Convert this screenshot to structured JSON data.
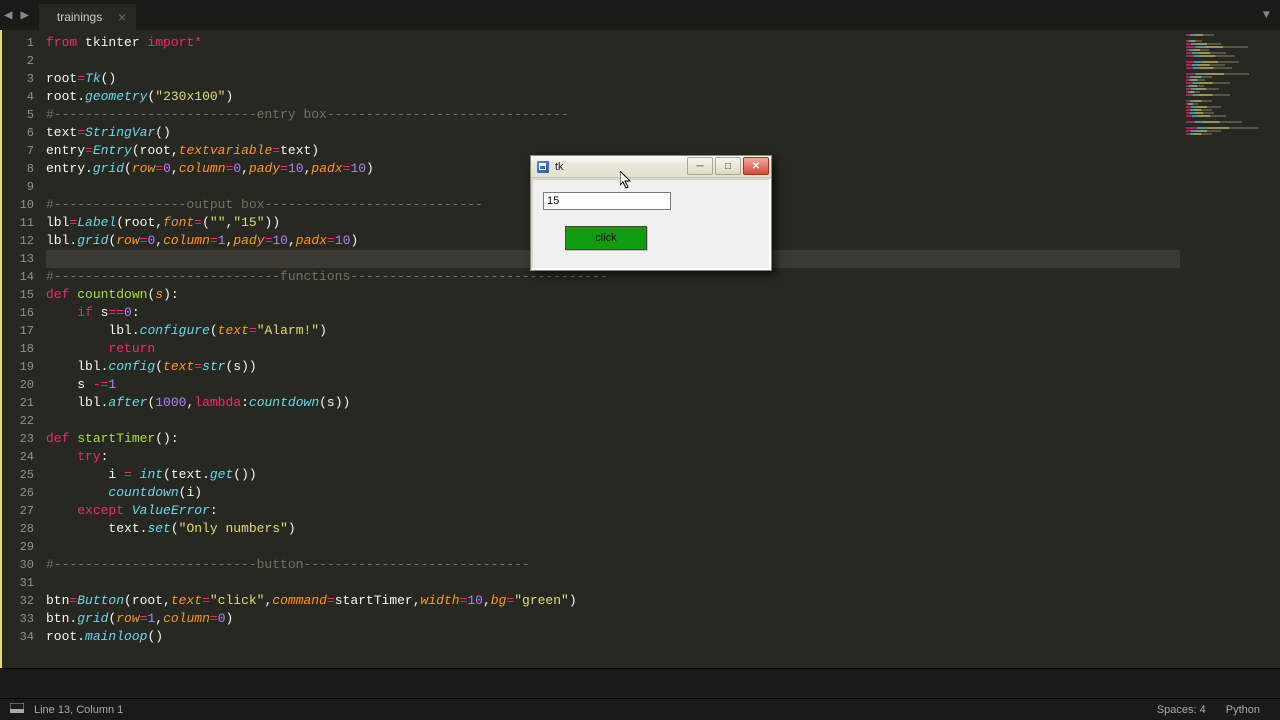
{
  "tabbar": {
    "tab_label": "trainings"
  },
  "gutter": {
    "start": 1,
    "end": 34
  },
  "code": {
    "lines": [
      [
        [
          "kw",
          "from"
        ],
        [
          "pl",
          " tkinter "
        ],
        [
          "kw",
          "import"
        ],
        [
          "op",
          "*"
        ]
      ],
      [
        [
          "pl",
          ""
        ]
      ],
      [
        [
          "pl",
          "root"
        ],
        [
          "op",
          "="
        ],
        [
          "ty",
          "Tk"
        ],
        [
          "pl",
          "()"
        ]
      ],
      [
        [
          "pl",
          "root"
        ],
        [
          "pl",
          "."
        ],
        [
          "fn",
          "geometry"
        ],
        [
          "pl",
          "("
        ],
        [
          "str",
          "\"230x100\""
        ],
        [
          "pl",
          ")"
        ]
      ],
      [
        [
          "cm",
          "#--------------------------entry box-------------------------------"
        ]
      ],
      [
        [
          "pl",
          "text"
        ],
        [
          "op",
          "="
        ],
        [
          "ty",
          "StringVar"
        ],
        [
          "pl",
          "()"
        ]
      ],
      [
        [
          "pl",
          "entry"
        ],
        [
          "op",
          "="
        ],
        [
          "ty",
          "Entry"
        ],
        [
          "pl",
          "(root,"
        ],
        [
          "prm",
          "textvariable"
        ],
        [
          "op",
          "="
        ],
        [
          "pl",
          "text)"
        ]
      ],
      [
        [
          "pl",
          "entry"
        ],
        [
          "pl",
          "."
        ],
        [
          "fn",
          "grid"
        ],
        [
          "pl",
          "("
        ],
        [
          "prm",
          "row"
        ],
        [
          "op",
          "="
        ],
        [
          "num",
          "0"
        ],
        [
          "pl",
          ","
        ],
        [
          "prm",
          "column"
        ],
        [
          "op",
          "="
        ],
        [
          "num",
          "0"
        ],
        [
          "pl",
          ","
        ],
        [
          "prm",
          "pady"
        ],
        [
          "op",
          "="
        ],
        [
          "num",
          "10"
        ],
        [
          "pl",
          ","
        ],
        [
          "prm",
          "padx"
        ],
        [
          "op",
          "="
        ],
        [
          "num",
          "10"
        ],
        [
          "pl",
          ")"
        ]
      ],
      [
        [
          "pl",
          ""
        ]
      ],
      [
        [
          "cm",
          "#-----------------output box----------------------------"
        ]
      ],
      [
        [
          "pl",
          "lbl"
        ],
        [
          "op",
          "="
        ],
        [
          "ty",
          "Label"
        ],
        [
          "pl",
          "(root,"
        ],
        [
          "prm",
          "font"
        ],
        [
          "op",
          "="
        ],
        [
          "pl",
          "("
        ],
        [
          "str",
          "\"\""
        ],
        [
          "pl",
          ","
        ],
        [
          "str",
          "\"15\""
        ],
        [
          "pl",
          "))"
        ]
      ],
      [
        [
          "pl",
          "lbl"
        ],
        [
          "pl",
          "."
        ],
        [
          "fn",
          "grid"
        ],
        [
          "pl",
          "("
        ],
        [
          "prm",
          "row"
        ],
        [
          "op",
          "="
        ],
        [
          "num",
          "0"
        ],
        [
          "pl",
          ","
        ],
        [
          "prm",
          "column"
        ],
        [
          "op",
          "="
        ],
        [
          "num",
          "1"
        ],
        [
          "pl",
          ","
        ],
        [
          "prm",
          "pady"
        ],
        [
          "op",
          "="
        ],
        [
          "num",
          "10"
        ],
        [
          "pl",
          ","
        ],
        [
          "prm",
          "padx"
        ],
        [
          "op",
          "="
        ],
        [
          "num",
          "10"
        ],
        [
          "pl",
          ")"
        ]
      ],
      [
        [
          "pl",
          ""
        ]
      ],
      [
        [
          "cm",
          "#-----------------------------functions---------------------------------"
        ]
      ],
      [
        [
          "kw",
          "def"
        ],
        [
          "pl",
          " "
        ],
        [
          "nm",
          "countdown"
        ],
        [
          "pl",
          "("
        ],
        [
          "prm",
          "s"
        ],
        [
          "pl",
          "):"
        ]
      ],
      [
        [
          "pl",
          "    "
        ],
        [
          "kw",
          "if"
        ],
        [
          "pl",
          " s"
        ],
        [
          "op",
          "=="
        ],
        [
          "num",
          "0"
        ],
        [
          "pl",
          ":"
        ]
      ],
      [
        [
          "pl",
          "        lbl"
        ],
        [
          "pl",
          "."
        ],
        [
          "fn",
          "configure"
        ],
        [
          "pl",
          "("
        ],
        [
          "prm",
          "text"
        ],
        [
          "op",
          "="
        ],
        [
          "str",
          "\"Alarm!\""
        ],
        [
          "pl",
          ")"
        ]
      ],
      [
        [
          "pl",
          "        "
        ],
        [
          "kw",
          "return"
        ]
      ],
      [
        [
          "pl",
          "    lbl"
        ],
        [
          "pl",
          "."
        ],
        [
          "fn",
          "config"
        ],
        [
          "pl",
          "("
        ],
        [
          "prm",
          "text"
        ],
        [
          "op",
          "="
        ],
        [
          "fn",
          "str"
        ],
        [
          "pl",
          "(s))"
        ]
      ],
      [
        [
          "pl",
          "    s "
        ],
        [
          "op",
          "-="
        ],
        [
          "num",
          "1"
        ]
      ],
      [
        [
          "pl",
          "    lbl"
        ],
        [
          "pl",
          "."
        ],
        [
          "fn",
          "after"
        ],
        [
          "pl",
          "("
        ],
        [
          "num",
          "1000"
        ],
        [
          "pl",
          ","
        ],
        [
          "kw",
          "lambda"
        ],
        [
          "pl",
          ":"
        ],
        [
          "fn",
          "countdown"
        ],
        [
          "pl",
          "(s))"
        ]
      ],
      [
        [
          "pl",
          ""
        ]
      ],
      [
        [
          "kw",
          "def"
        ],
        [
          "pl",
          " "
        ],
        [
          "nm",
          "startTimer"
        ],
        [
          "pl",
          "():"
        ]
      ],
      [
        [
          "pl",
          "    "
        ],
        [
          "kw",
          "try"
        ],
        [
          "pl",
          ":"
        ]
      ],
      [
        [
          "pl",
          "        i "
        ],
        [
          "op",
          "="
        ],
        [
          "pl",
          " "
        ],
        [
          "fn",
          "int"
        ],
        [
          "pl",
          "(text"
        ],
        [
          "pl",
          "."
        ],
        [
          "fn",
          "get"
        ],
        [
          "pl",
          "())"
        ]
      ],
      [
        [
          "pl",
          "        "
        ],
        [
          "fn",
          "countdown"
        ],
        [
          "pl",
          "(i)"
        ]
      ],
      [
        [
          "pl",
          "    "
        ],
        [
          "kw",
          "except"
        ],
        [
          "pl",
          " "
        ],
        [
          "ty",
          "ValueError"
        ],
        [
          "pl",
          ":"
        ]
      ],
      [
        [
          "pl",
          "        text"
        ],
        [
          "pl",
          "."
        ],
        [
          "fn",
          "set"
        ],
        [
          "pl",
          "("
        ],
        [
          "str",
          "\"Only numbers\""
        ],
        [
          "pl",
          ")"
        ]
      ],
      [
        [
          "pl",
          ""
        ]
      ],
      [
        [
          "cm",
          "#--------------------------button-----------------------------"
        ]
      ],
      [
        [
          "pl",
          ""
        ]
      ],
      [
        [
          "pl",
          "btn"
        ],
        [
          "op",
          "="
        ],
        [
          "ty",
          "Button"
        ],
        [
          "pl",
          "(root,"
        ],
        [
          "prm",
          "text"
        ],
        [
          "op",
          "="
        ],
        [
          "str",
          "\"click\""
        ],
        [
          "pl",
          ","
        ],
        [
          "prm",
          "command"
        ],
        [
          "op",
          "="
        ],
        [
          "pl",
          "startTimer,"
        ],
        [
          "prm",
          "width"
        ],
        [
          "op",
          "="
        ],
        [
          "num",
          "10"
        ],
        [
          "pl",
          ","
        ],
        [
          "prm",
          "bg"
        ],
        [
          "op",
          "="
        ],
        [
          "str",
          "\"green\""
        ],
        [
          "pl",
          ")"
        ]
      ],
      [
        [
          "pl",
          "btn"
        ],
        [
          "pl",
          "."
        ],
        [
          "fn",
          "grid"
        ],
        [
          "pl",
          "("
        ],
        [
          "prm",
          "row"
        ],
        [
          "op",
          "="
        ],
        [
          "num",
          "1"
        ],
        [
          "pl",
          ","
        ],
        [
          "prm",
          "column"
        ],
        [
          "op",
          "="
        ],
        [
          "num",
          "0"
        ],
        [
          "pl",
          ")"
        ]
      ],
      [
        [
          "pl",
          "root"
        ],
        [
          "pl",
          "."
        ],
        [
          "fn",
          "mainloop"
        ],
        [
          "pl",
          "()"
        ]
      ]
    ],
    "active_line": 13
  },
  "tk": {
    "title": "tk",
    "entry_value": "15",
    "button_label": "click"
  },
  "status": {
    "position": "Line 13, Column 1",
    "spaces": "Spaces: 4",
    "syntax": "Python"
  }
}
